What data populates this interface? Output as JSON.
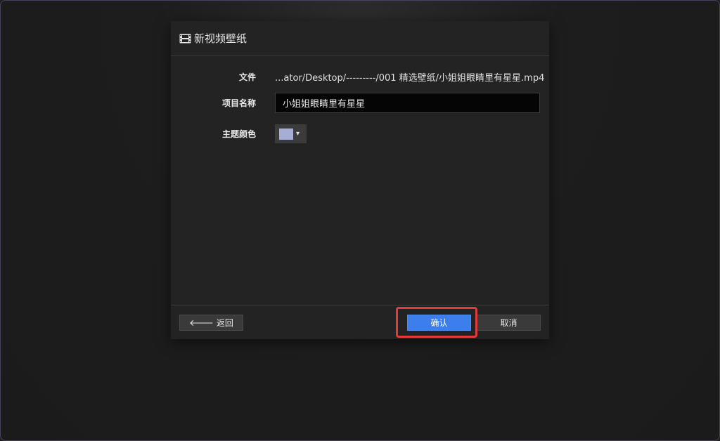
{
  "dialog": {
    "title": "新视频壁纸",
    "title_icon": "film-icon"
  },
  "form": {
    "file_label": "文件",
    "file_value": "...ator/Desktop/---------/001 精选壁纸/小姐姐眼睛里有星星.mp4",
    "name_label": "项目名称",
    "name_value": "小姐姐眼睛里有星星",
    "color_label": "主题颜色",
    "color_value": "#a6aed6",
    "color_caret": "▾"
  },
  "footer": {
    "back_arrow": "🡐",
    "back_label": "返回",
    "confirm_label": "确认",
    "cancel_label": "取消"
  },
  "colors": {
    "accent": "#3b7eec",
    "highlight": "#e23b3b"
  }
}
